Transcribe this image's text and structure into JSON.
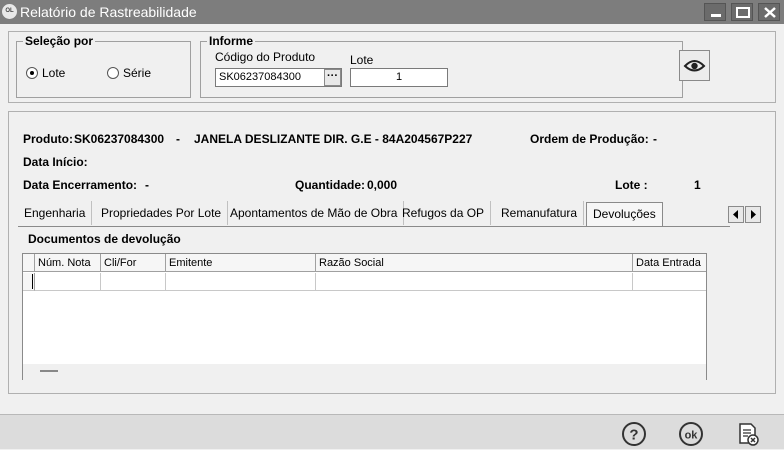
{
  "window": {
    "app_icon": "OL",
    "title": "Relatório de Rastreabilidade",
    "controls": [
      "minimize-icon",
      "maximize-icon",
      "close-icon"
    ]
  },
  "selecao": {
    "legend": "Seleção por",
    "options": [
      {
        "label": "Lote",
        "selected": true
      },
      {
        "label": "Série",
        "selected": false
      }
    ]
  },
  "informe": {
    "legend": "Informe",
    "codigo_label": "Código do Produto",
    "codigo_value": "SK06237084300",
    "browse_label": "···",
    "lote_label": "Lote",
    "lote_value": "1"
  },
  "view_button_icon": "eye-icon",
  "details": {
    "produto_label": "Produto:",
    "produto_value": "SK06237084300",
    "dash1": "-",
    "produto_desc": "JANELA DESLIZANTE DIR. G.E - 84A204567P227",
    "ordem_label": "Ordem de Produção:",
    "ordem_value": "-",
    "data_inicio_label": "Data Início:",
    "data_encerramento_label": "Data Encerramento:",
    "data_encerramento_value": "-",
    "quantidade_label": "Quantidade:",
    "quantidade_value": "0,000",
    "lote_label": "Lote :",
    "lote_value": "1"
  },
  "tabs": [
    {
      "label": "Engenharia",
      "active": false
    },
    {
      "label": "Propriedades Por Lote",
      "active": false
    },
    {
      "label": "Apontamentos de Mão de Obra",
      "active": false
    },
    {
      "label": "Refugos da OP",
      "active": false
    },
    {
      "label": "Remanufatura",
      "active": false
    },
    {
      "label": "Devoluções",
      "active": true
    }
  ],
  "tab_scroll": [
    "chevron-left-icon",
    "chevron-right-icon"
  ],
  "section_title": "Documentos de devolução",
  "grid": {
    "columns": [
      "Núm. Nota",
      "Cli/For",
      "Emitente",
      "Razão Social",
      "Data Entrada"
    ]
  },
  "footer_icons": [
    "help-icon",
    "ok-icon",
    "cancel-report-icon"
  ],
  "footer_ok_label": "ok",
  "footer_help_label": "?"
}
